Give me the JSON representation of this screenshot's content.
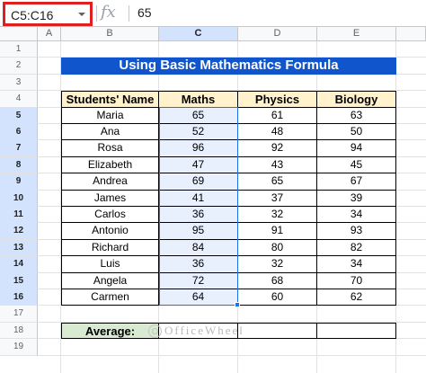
{
  "formula_bar": {
    "name_box": "C5:C16",
    "fx_label": "fx",
    "value": "65"
  },
  "columns": [
    "A",
    "B",
    "C",
    "D",
    "E"
  ],
  "rows": [
    "1",
    "2",
    "3",
    "4",
    "5",
    "6",
    "7",
    "8",
    "9",
    "10",
    "11",
    "12",
    "13",
    "14",
    "15",
    "16",
    "17",
    "18",
    "19"
  ],
  "title": "Using Basic Mathematics Formula",
  "table": {
    "headers": [
      "Students' Name",
      "Maths",
      "Physics",
      "Biology"
    ],
    "rows": [
      [
        "Maria",
        "65",
        "61",
        "63"
      ],
      [
        "Ana",
        "52",
        "48",
        "50"
      ],
      [
        "Rosa",
        "96",
        "92",
        "94"
      ],
      [
        "Elizabeth",
        "47",
        "43",
        "45"
      ],
      [
        "Andrea",
        "69",
        "65",
        "67"
      ],
      [
        "James",
        "41",
        "37",
        "39"
      ],
      [
        "Carlos",
        "36",
        "32",
        "34"
      ],
      [
        "Antonio",
        "95",
        "91",
        "93"
      ],
      [
        "Richard",
        "84",
        "80",
        "82"
      ],
      [
        "Luis",
        "36",
        "32",
        "34"
      ],
      [
        "Angela",
        "72",
        "68",
        "70"
      ],
      [
        "Carmen",
        "64",
        "60",
        "62"
      ]
    ],
    "average_label": "Average:"
  },
  "watermark": "OfficeWheel",
  "colors": {
    "banner": "#1155cc",
    "header_fill": "#fff2cc",
    "average_fill": "#d9ead3",
    "selection": "#1a73e8",
    "namebox_highlight": "#e02020"
  }
}
